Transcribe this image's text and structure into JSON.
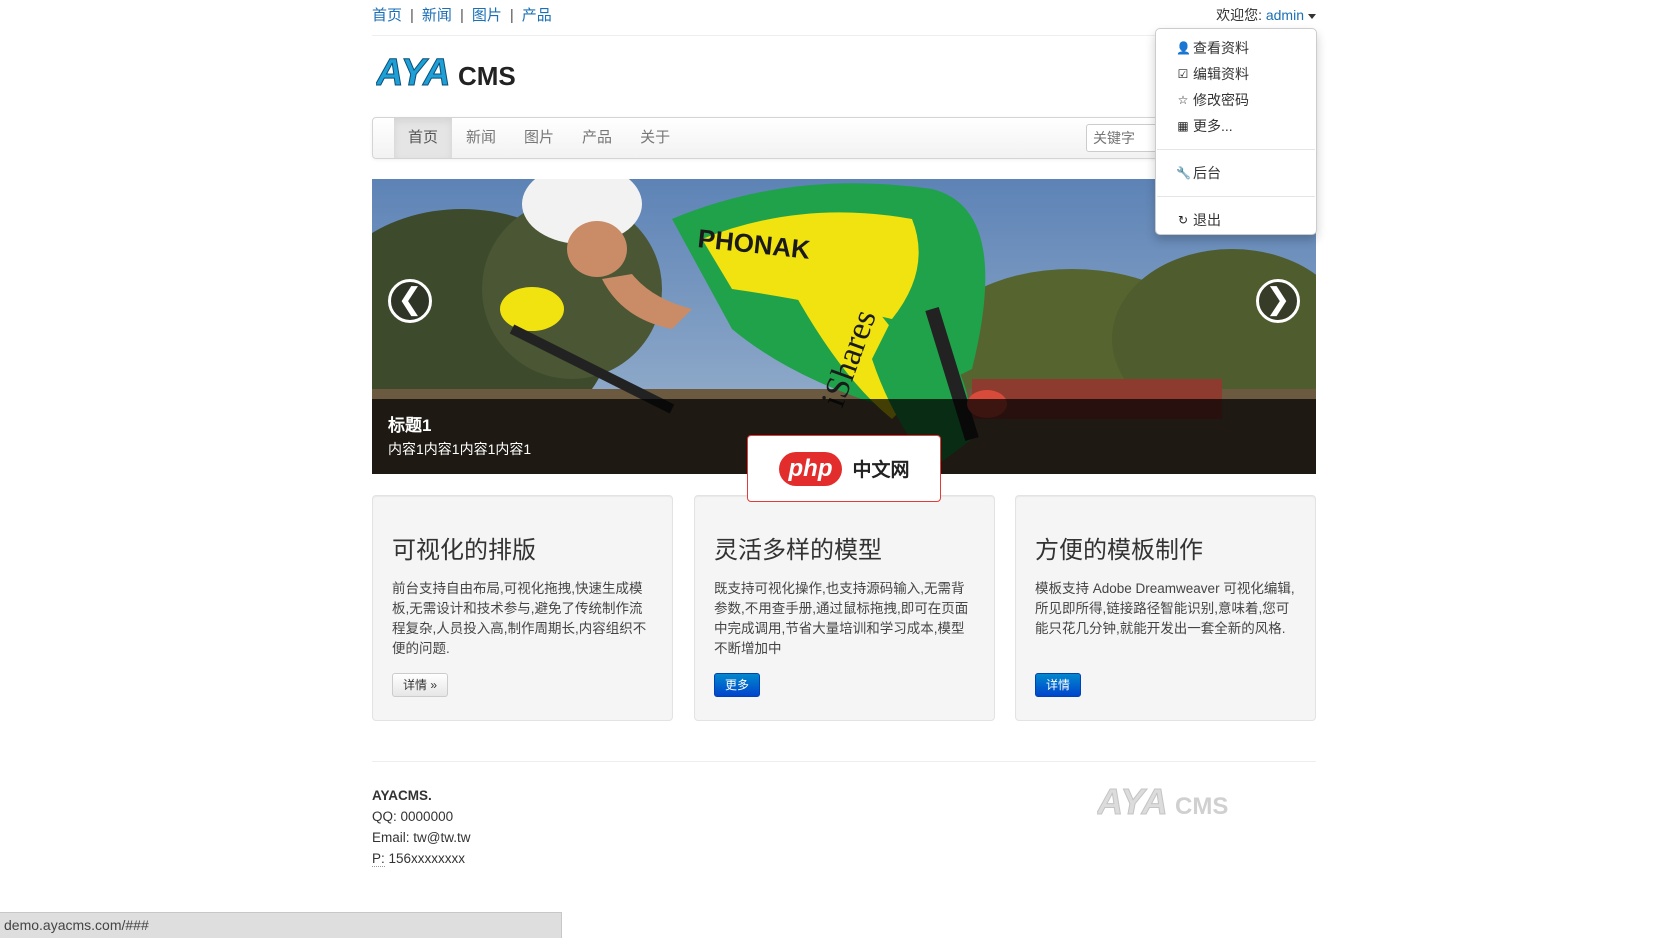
{
  "top_links": [
    "首页",
    "新闻",
    "图片",
    "产品"
  ],
  "separator": "|",
  "welcome": {
    "label": "欢迎您:",
    "user": "admin"
  },
  "logo": {
    "part1": "AYA",
    "part2": "CMS"
  },
  "nav": {
    "items": [
      "首页",
      "新闻",
      "图片",
      "产品",
      "关于"
    ],
    "active_index": 0
  },
  "search": {
    "placeholder": "关键字"
  },
  "user_menu": {
    "items": [
      {
        "icon": "user-icon",
        "glyph": "👤",
        "label": "查看资料"
      },
      {
        "icon": "edit-icon",
        "glyph": "☑",
        "label": "编辑资料"
      },
      {
        "icon": "star-icon",
        "glyph": "☆",
        "label": "修改密码"
      },
      {
        "icon": "grid-icon",
        "glyph": "▦",
        "label": "更多..."
      },
      {
        "icon": "wrench-icon",
        "glyph": "🔧",
        "label": "后台"
      },
      {
        "icon": "logout-icon",
        "glyph": "↻",
        "label": "退出"
      }
    ]
  },
  "carousel": {
    "caption_title": "标题1",
    "caption_text": "内容1内容1内容1内容1",
    "prev": "❮",
    "next": "❯",
    "jersey_text": "PHONAK",
    "sleeve_text": "iShares"
  },
  "watermark": {
    "pill": "php",
    "text": "中文网"
  },
  "cards": [
    {
      "title": "可视化的排版",
      "text": "前台支持自由布局,可视化拖拽,快速生成模板,无需设计和技术参与,避免了传统制作流程复杂,人员投入高,制作周期长,内容组织不便的问题.",
      "button": "详情 »"
    },
    {
      "title": "灵活多样的模型",
      "text": "既支持可视化操作,也支持源码输入,无需背参数,不用查手册,通过鼠标拖拽,即可在页面中完成调用,节省大量培训和学习成本,模型不断增加中",
      "button": "更多"
    },
    {
      "title": "方便的模板制作",
      "text": "模板支持 Adobe Dreamweaver 可视化编辑,所见即所得,链接路径智能识别,意味着,您可能只花几分钟,就能开发出一套全新的风格.",
      "button": "详情"
    }
  ],
  "footer": {
    "brand": "AYACMS.",
    "qq_label": "QQ:",
    "qq": "0000000",
    "email_label": "Email:",
    "email": "tw@tw.tw",
    "phone_label": "P:",
    "phone": "156xxxxxxxx"
  },
  "status_url": "demo.ayacms.com/###",
  "colors": {
    "link": "#1a6fb5",
    "logo_blue": "#1e9fd6",
    "primary_button": "#0066cc",
    "watermark_red": "#e32c2c"
  }
}
